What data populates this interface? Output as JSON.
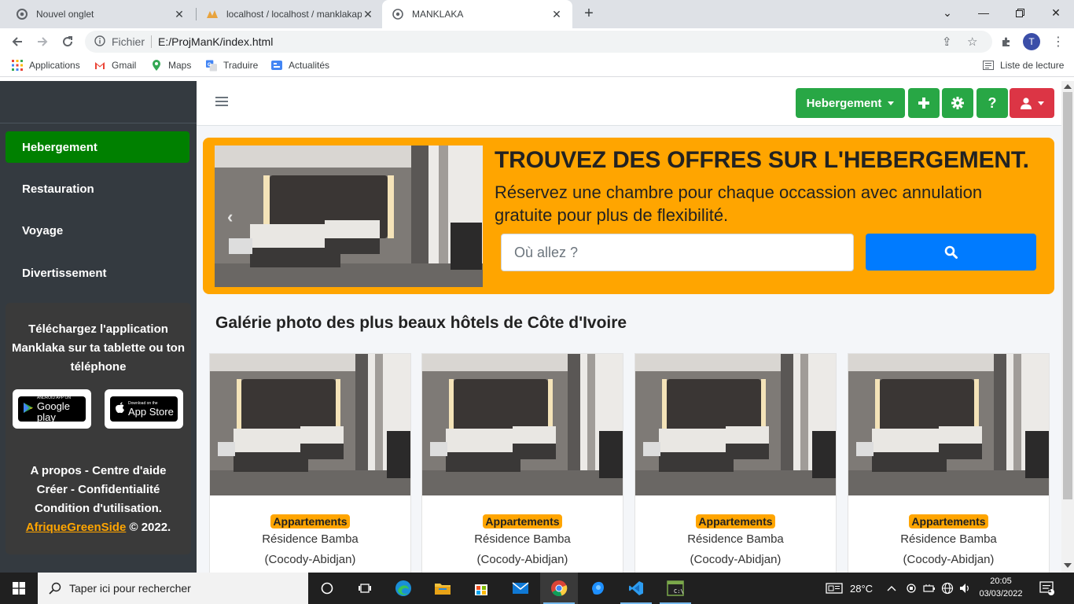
{
  "browser": {
    "tabs": [
      {
        "title": "Nouvel onglet",
        "active": false
      },
      {
        "title": "localhost / localhost / manklakap",
        "active": false
      },
      {
        "title": "MANKLAKA",
        "active": true
      }
    ],
    "address": {
      "scheme": "Fichier",
      "url": "E:/ProjManK/index.html"
    },
    "profile_initial": "T",
    "bookmarks": [
      "Applications",
      "Gmail",
      "Maps",
      "Traduire",
      "Actualités"
    ],
    "reading_list": "Liste de lecture"
  },
  "sidebar": {
    "items": [
      {
        "label": "Hebergement",
        "active": true
      },
      {
        "label": "Restauration",
        "active": false
      },
      {
        "label": "Voyage",
        "active": false
      },
      {
        "label": "Divertissement",
        "active": false
      }
    ],
    "app_promo": "Téléchargez l'application Manklaka sur ta tablette ou ton téléphone",
    "stores": [
      {
        "small": "ANDROID APP ON",
        "big": "Google play"
      },
      {
        "small": "Download on the",
        "big": "App Store"
      }
    ],
    "footer": {
      "line1": "A propos - Centre d'aide",
      "line2": "Créer - Confidentialité",
      "line3": "Condition d'utilisation.",
      "company": "AfriqueGreenSide",
      "copyright": "© 2022."
    }
  },
  "navbar": {
    "dropdown_label": "Hebergement",
    "icons": [
      "plus-icon",
      "gear-icon",
      "question-icon",
      "user-icon"
    ]
  },
  "hero": {
    "title": "TROUVEZ DES OFFRES SUR L'HEBERGEMENT.",
    "subtitle": "Réservez une chambre pour chaque occassion avec annulation gratuite pour plus de flexibilité.",
    "search_placeholder": "Où allez ?"
  },
  "gallery": {
    "title": "Galérie photo des plus beaux hôtels de Côte d'Ivoire",
    "cards": [
      {
        "category": "Appartements",
        "name": "Résidence Bamba",
        "location": "(Cocody-Abidjan)"
      },
      {
        "category": "Appartements",
        "name": "Résidence Bamba",
        "location": "(Cocody-Abidjan)"
      },
      {
        "category": "Appartements",
        "name": "Résidence Bamba",
        "location": "(Cocody-Abidjan)"
      },
      {
        "category": "Appartements",
        "name": "Résidence Bamba",
        "location": "(Cocody-Abidjan)"
      }
    ]
  },
  "taskbar": {
    "search_placeholder": "Taper ici pour rechercher",
    "weather": "28°C",
    "time": "20:05",
    "date": "03/03/2022",
    "notifications": "1"
  },
  "colors": {
    "sidebar_bg": "#343a40",
    "active_green": "#008000",
    "button_green": "#28a745",
    "button_red": "#dc3545",
    "hero_orange": "#ffa500",
    "search_blue": "#007bff"
  }
}
